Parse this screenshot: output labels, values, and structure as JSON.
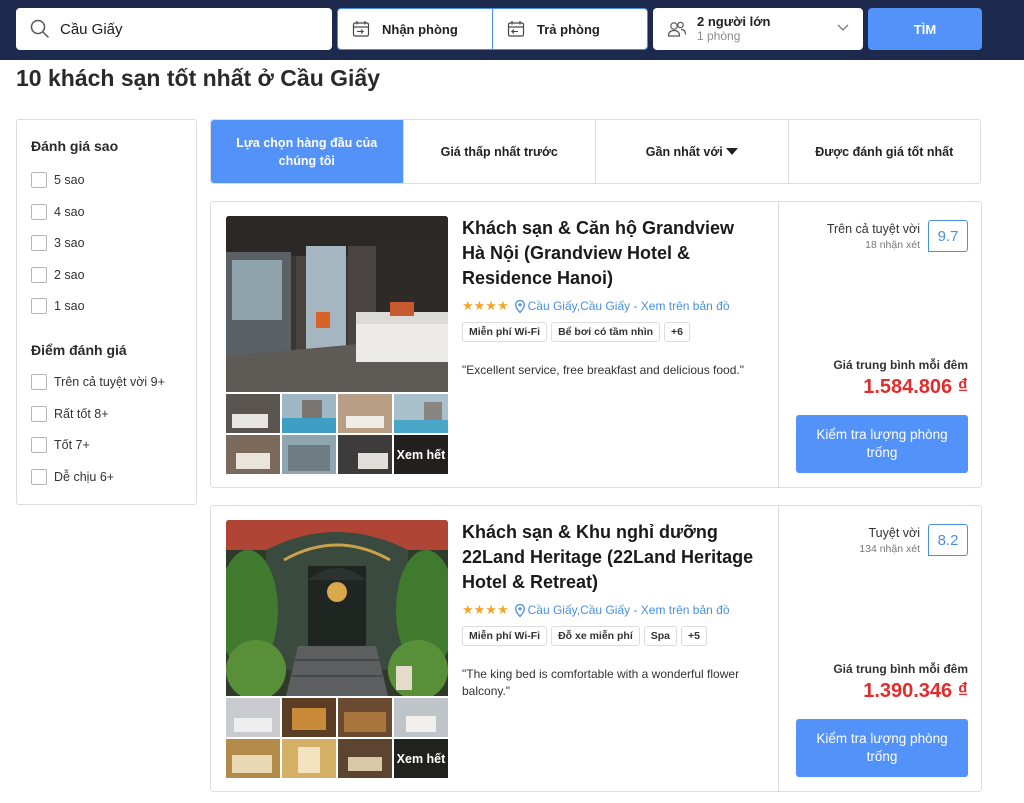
{
  "search": {
    "destination_value": "Cầu Giấy",
    "checkin_label": "Nhận phòng",
    "checkout_label": "Trả phòng",
    "guests_label": "2 người lớn",
    "rooms_label": "1 phòng",
    "find_button": "TÌM"
  },
  "page_title": "10 khách sạn tốt nhất ở Cầu Giấy",
  "filters": {
    "stars_title": "Đánh giá sao",
    "stars_options": [
      "5 sao",
      "4 sao",
      "3 sao",
      "2 sao",
      "1 sao"
    ],
    "score_title": "Điểm đánh giá",
    "score_options": [
      "Trên cả tuyệt vời 9+",
      "Rất tốt 8+",
      "Tốt 7+",
      "Dễ chịu 6+"
    ]
  },
  "sort_tabs": [
    {
      "label": "Lựa chọn hàng đầu của chúng tôi",
      "active": true
    },
    {
      "label": "Giá thấp nhất trước",
      "active": false
    },
    {
      "label": "Gần nhất với",
      "active": false
    },
    {
      "label": "Được đánh giá tốt nhất",
      "active": false
    }
  ],
  "hotels": [
    {
      "name": "Khách sạn & Căn hộ Grandview Hà Nội (Grandview Hotel & Residence Hanoi)",
      "stars": 4,
      "stars_text": "★★★★",
      "location": "Cầu Giấy,Cầu Giấy - Xem trên bản đồ",
      "amenities": [
        "Miễn phí Wi-Fi",
        "Bể bơi có tầm nhìn",
        "+6"
      ],
      "review": "\"Excellent service, free breakfast and delicious food.\"",
      "rating_text": "Trên cả tuyệt vời",
      "review_count": "18 nhận xét",
      "score": "9.7",
      "price_label": "Giá trung bình mỗi đêm",
      "price": "1.584.806 ₫",
      "book_button": "Kiểm tra lượng phòng trống",
      "see_all": "Xem hết"
    },
    {
      "name": "Khách sạn & Khu nghỉ dưỡng 22Land Heritage (22Land Heritage Hotel & Retreat)",
      "stars": 4,
      "stars_text": "★★★★",
      "location": "Cầu Giấy,Cầu Giấy - Xem trên bản đồ",
      "amenities": [
        "Miễn phí Wi-Fi",
        "Đỗ xe miễn phí",
        "Spa",
        "+5"
      ],
      "review": "\"The king bed is comfortable with a wonderful flower balcony.\"",
      "rating_text": "Tuyệt vời",
      "review_count": "134 nhận xét",
      "score": "8.2",
      "price_label": "Giá trung bình mỗi đêm",
      "price": "1.390.346 ₫",
      "book_button": "Kiểm tra lượng phòng trống",
      "see_all": "Xem hết"
    }
  ],
  "colors": {
    "topbar": "#1d2a4d",
    "accent": "#5392f9",
    "price": "#e12d2d",
    "stars": "#f5a623"
  }
}
